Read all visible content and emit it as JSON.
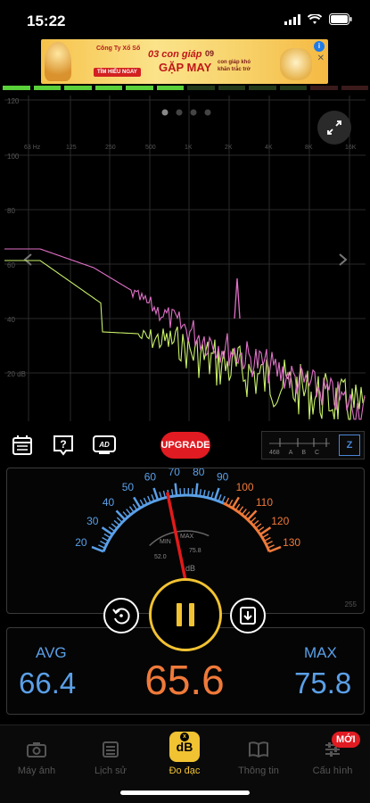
{
  "status": {
    "time": "15:22"
  },
  "ad": {
    "brand": "Công Ty Xổ Số",
    "cta": "TÌM HIỂU NGAY",
    "headline_top": "03 con giáp",
    "headline_main": "GẶP MAY",
    "side_top": "09",
    "side_text": "con giáp khó khăn trắc trở"
  },
  "spectrum": {
    "y_labels": [
      "120",
      "100",
      "80",
      "60",
      "40",
      "20 dB"
    ],
    "x_labels": [
      "63 Hz",
      "125",
      "250",
      "500",
      "1K",
      "2K",
      "4K",
      "8K",
      "16K"
    ],
    "page_dots": 4,
    "active_dot": 0
  },
  "toolbar": {
    "upgrade_label": "UPGRADE",
    "weighting": {
      "scale_value": "468",
      "options": [
        "A",
        "B",
        "C"
      ],
      "selected": "Z"
    }
  },
  "gauge": {
    "blue_ticks": [
      "20",
      "30",
      "40",
      "50",
      "60",
      "70",
      "80",
      "90"
    ],
    "orange_ticks": [
      "100",
      "110",
      "120",
      "130"
    ],
    "min_label": "MIN",
    "max_label": "MAX",
    "min_value": "52.0",
    "max_value": "75.8",
    "unit": "dB",
    "scale_max": "255",
    "needle_value": 65.6
  },
  "stats": {
    "avg_label": "AVG",
    "avg_value": "66.4",
    "current_value": "65.6",
    "max_label": "MAX",
    "max_value": "75.8"
  },
  "tabs": [
    {
      "label": "Máy ảnh",
      "icon": "camera-icon"
    },
    {
      "label": "Lịch sử",
      "icon": "history-icon"
    },
    {
      "label": "Đo đạc",
      "icon": "db-meter-icon"
    },
    {
      "label": "Thông tin",
      "icon": "book-icon"
    },
    {
      "label": "Cấu hình",
      "icon": "sliders-icon"
    }
  ],
  "new_badge": "MỚI",
  "colors": {
    "accent": "#f1c232",
    "blue": "#5aa0e8",
    "orange": "#f07a3a",
    "red": "#e11b22",
    "pink_series": "#e070c8",
    "green_series": "#c8f06a"
  }
}
